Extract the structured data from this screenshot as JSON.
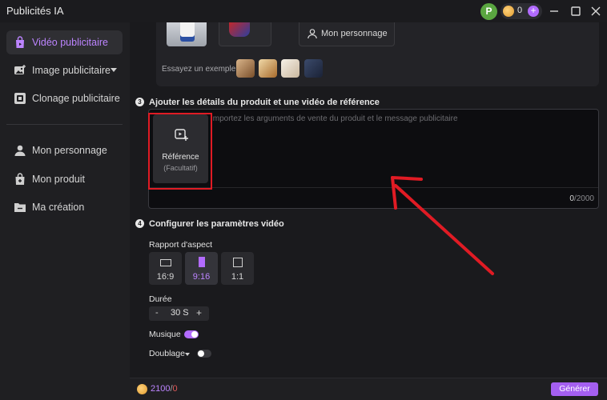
{
  "app": {
    "title": "Publicités IA"
  },
  "titlebar": {
    "avatar_letter": "P",
    "coin_count": "0",
    "plus_label": "+"
  },
  "sidebar": {
    "items": [
      {
        "label": "Vidéo publicitaire",
        "icon": "video-bag-icon",
        "active": true
      },
      {
        "label": "Image publicitaire",
        "icon": "image-icon",
        "has_dropdown": true
      },
      {
        "label": "Clonage publicitaire",
        "icon": "clone-icon"
      },
      {
        "label": "Mon personnage",
        "icon": "person-icon"
      },
      {
        "label": "Mon produit",
        "icon": "product-bag-icon"
      },
      {
        "label": "Ma création",
        "icon": "folder-icon"
      }
    ]
  },
  "top_card": {
    "persona_button": "Mon personnage",
    "example_label": "Essayez un exemple :"
  },
  "step3": {
    "number": "3",
    "title": "Ajouter les détails du produit et une vidéo de référence",
    "reference_label": "Référence",
    "reference_sub": "(Facultatif)",
    "placeholder": "Importez les arguments de vente du produit et le message publicitaire",
    "char_current": "0",
    "char_max": "/2000"
  },
  "step4": {
    "number": "4",
    "title": "Configurer les paramètres vidéo",
    "aspect_label": "Rapport d'aspect",
    "aspect_options": [
      {
        "label": "16:9",
        "selected": false
      },
      {
        "label": "9:16",
        "selected": true
      },
      {
        "label": "1:1",
        "selected": false
      }
    ],
    "duration_label": "Durée",
    "duration_minus": "-",
    "duration_value": "30 S",
    "duration_plus": "+",
    "music_label": "Musique",
    "music_on": true,
    "dubbing_label": "Doublage",
    "dubbing_on": false
  },
  "footer": {
    "credits": "2100",
    "separator": "/",
    "cost": "0",
    "generate_label": "Générer"
  },
  "colors": {
    "accent": "#b26bff",
    "highlight": "#e01b24",
    "background": "#1a1a1d"
  }
}
